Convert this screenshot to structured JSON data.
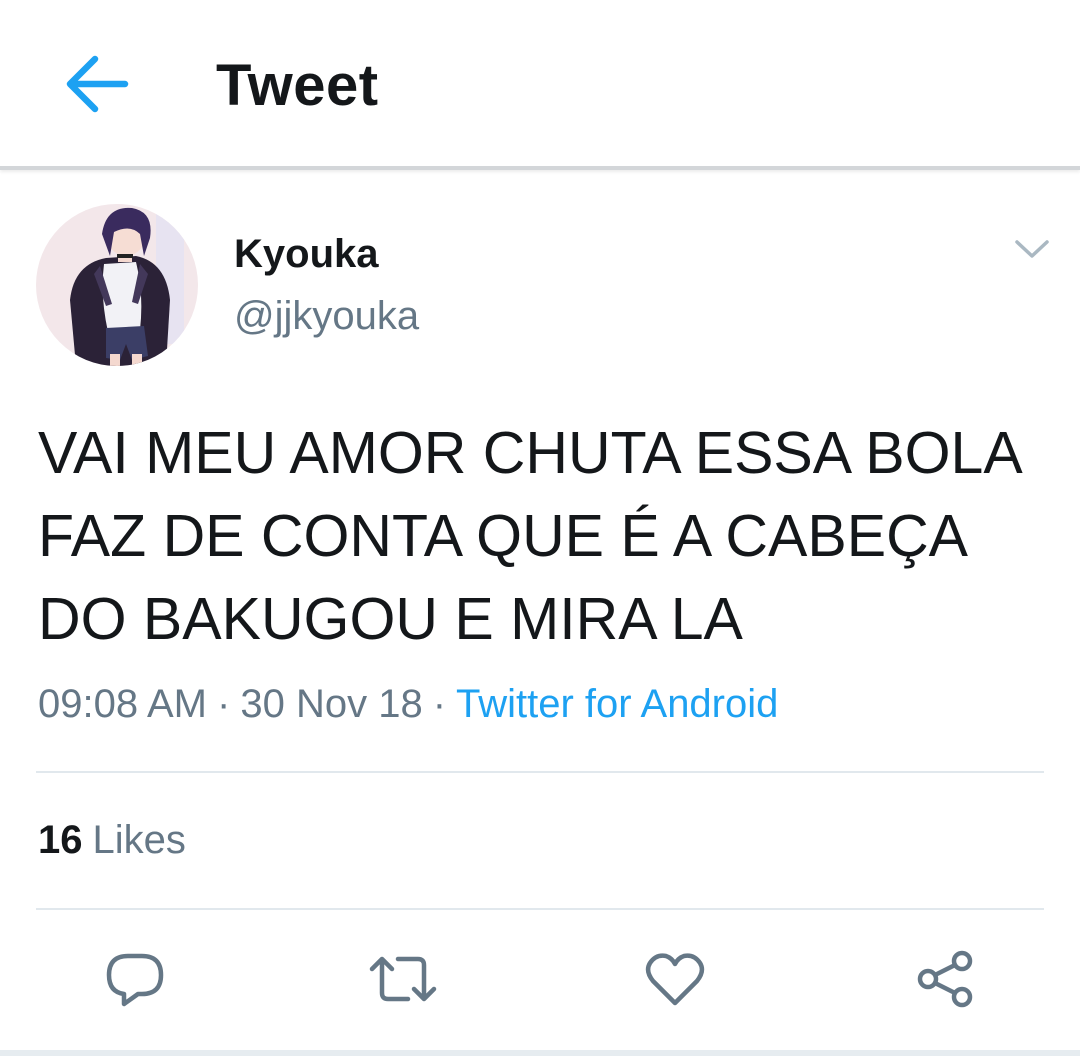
{
  "header": {
    "back_icon": "arrow-left-icon",
    "title": "Tweet",
    "accent_color": "#1da1f2"
  },
  "tweet": {
    "author": {
      "display_name": "Kyouka",
      "handle": "@jjkyouka",
      "avatar": "anime-character-avatar"
    },
    "menu_icon": "chevron-down-icon",
    "text": "VAI MEU AMOR CHUTA ESSA BOLA FAZ DE CONTA QUE É A CABEÇA DO BAKUGOU E MIRA LA",
    "time": "09:08 AM",
    "date": "30 Nov 18",
    "separator": "·",
    "source": "Twitter for Android",
    "likes_count": "16",
    "likes_label": "Likes"
  },
  "actions": [
    {
      "name": "reply",
      "icon": "reply-icon"
    },
    {
      "name": "retweet",
      "icon": "retweet-icon"
    },
    {
      "name": "like",
      "icon": "heart-icon"
    },
    {
      "name": "share",
      "icon": "share-icon"
    }
  ],
  "colors": {
    "text_primary": "#14171a",
    "text_secondary": "#657786",
    "link": "#1da1f2",
    "divider": "#e1e8ed"
  }
}
